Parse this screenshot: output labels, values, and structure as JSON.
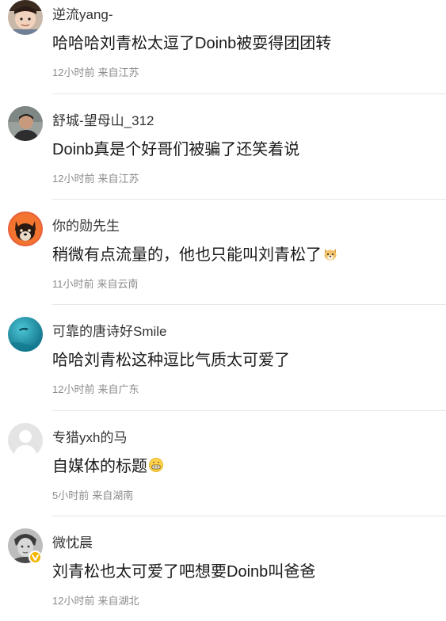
{
  "comments": [
    {
      "username": "逆流yang-",
      "text": "哈哈哈刘青松太逗了Doinb被耍得团团转",
      "time": "12小时前",
      "location": "来自江苏",
      "avatar_icon": "boy-face-avatar"
    },
    {
      "username": "舒城-望母山_312",
      "text": "Doinb真是个好哥们被骗了还笑着说",
      "time": "12小时前",
      "location": "来自江苏",
      "avatar_icon": "man-photo-avatar"
    },
    {
      "username": "你的勋先生",
      "text": "稍微有点流量的，他也只能叫刘青松了",
      "time": "11小时前",
      "location": "来自云南",
      "avatar_icon": "shiba-dog-avatar",
      "emoji": "doge-emoji"
    },
    {
      "username": "可靠的唐诗好Smile",
      "text": "哈哈刘青松这种逗比气质太可爱了",
      "time": "12小时前",
      "location": "来自广东",
      "avatar_icon": "ocean-avatar"
    },
    {
      "username": "专猎yxh的马",
      "text": "自媒体的标题",
      "time": "5小时前",
      "location": "来自湖南",
      "avatar_icon": "default-user-avatar",
      "emoji": "grin-emoji"
    },
    {
      "username": "微忱晨",
      "text": "刘青松也太可爱了吧想要Doinb叫爸爸",
      "time": "12小时前",
      "location": "来自湖北",
      "avatar_icon": "sketch-portrait-avatar",
      "verified": true
    }
  ],
  "colors": {
    "meta_text": "#8c8c8c",
    "divider": "#e6e6e6",
    "verified_badge": "#f5b400"
  }
}
